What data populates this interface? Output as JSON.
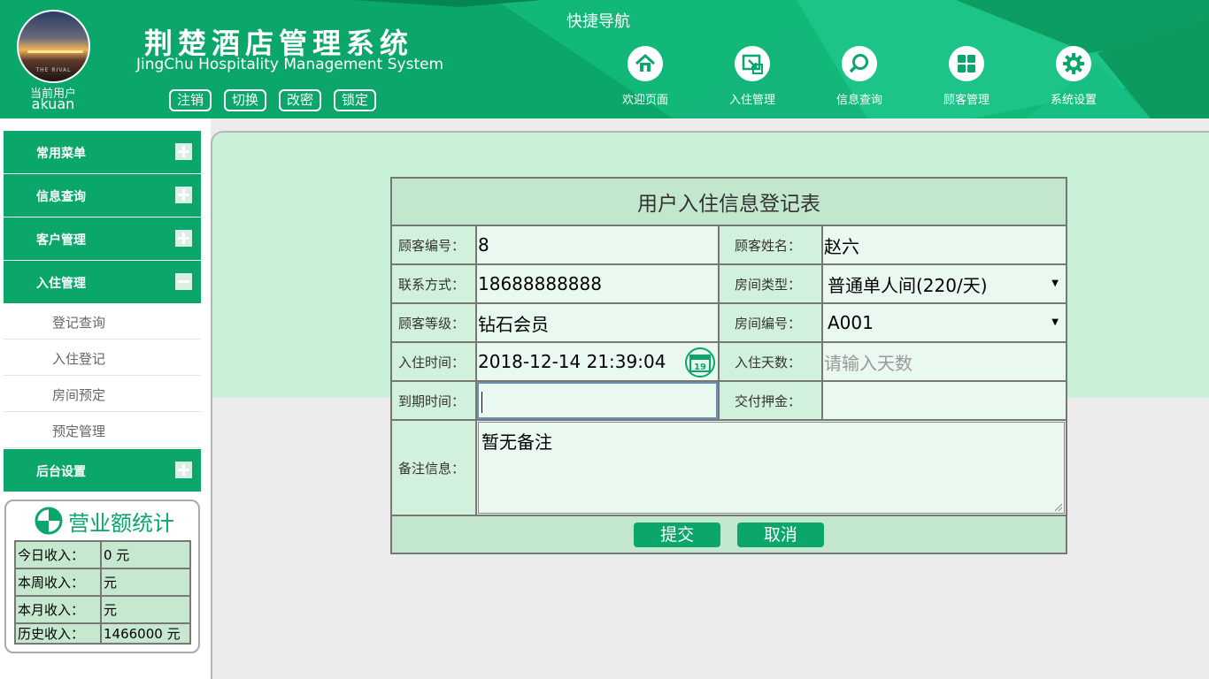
{
  "header": {
    "avatar_caption": "THE RIVAL",
    "current_user_label": "当前用户",
    "current_user_name": "akuan",
    "title": "荆楚酒店管理系统",
    "subtitle": "JingChu Hospitality Management System",
    "user_actions": [
      "注销",
      "切换",
      "改密",
      "锁定"
    ],
    "quick_nav_title": "快捷导航",
    "nav": [
      {
        "label": "欢迎页面",
        "icon": "home-icon"
      },
      {
        "label": "入住管理",
        "icon": "checkin-icon"
      },
      {
        "label": "信息查询",
        "icon": "search-icon"
      },
      {
        "label": "顾客管理",
        "icon": "grid-icon"
      },
      {
        "label": "系统设置",
        "icon": "gear-icon"
      }
    ],
    "accent_color": "#0aa66a"
  },
  "sidebar": {
    "groups": [
      {
        "label": "常用菜单",
        "toggle": "+"
      },
      {
        "label": "信息查询",
        "toggle": "+"
      },
      {
        "label": "客户管理",
        "toggle": "+"
      },
      {
        "label": "入住管理",
        "toggle": "−"
      },
      {
        "label": "后台设置",
        "toggle": "+"
      }
    ],
    "submenu": [
      "登记查询",
      "入住登记",
      "房间预定",
      "预定管理"
    ]
  },
  "stats": {
    "title": "营业额统计",
    "rows": [
      {
        "label": "今日收入：",
        "value": "0 元"
      },
      {
        "label": "本周收入：",
        "value": "元"
      },
      {
        "label": "本月收入：",
        "value": "元"
      },
      {
        "label": "历史收入：",
        "value": "1466000 元"
      }
    ]
  },
  "form": {
    "title": "用户入住信息登记表",
    "customer_id_label": "顾客编号：",
    "customer_id": "8",
    "customer_name_label": "顾客姓名：",
    "customer_name": "赵六",
    "phone_label": "联系方式：",
    "phone": "18688888888",
    "room_type_label": "房间类型：",
    "room_type": "普通单人间(220/天)",
    "level_label": "顾客等级：",
    "level": "钻石会员",
    "room_no_label": "房间编号：",
    "room_no": "A001",
    "checkin_time_label": "入住时间：",
    "checkin_time": "2018-12-14 21:39:04",
    "calendar_day": "19",
    "days_label": "入住天数：",
    "days_placeholder": "请输入天数",
    "expire_label": "到期时间：",
    "expire_value": "",
    "deposit_label": "交付押金：",
    "deposit_value": "",
    "remark_label": "备注信息：",
    "remark": "暂无备注",
    "submit": "提交",
    "cancel": "取消"
  }
}
